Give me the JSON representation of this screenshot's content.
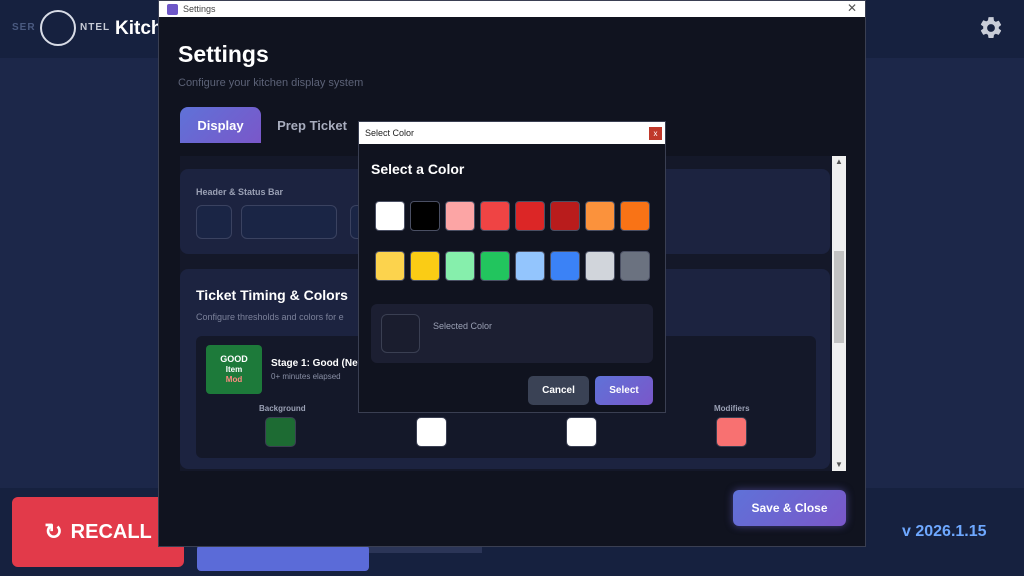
{
  "background_app": {
    "logo_text_left": "SER",
    "logo_text_right": "NTEL",
    "title": "Kitch",
    "recall_label": "RECALL",
    "recall_icon": "refresh-icon",
    "settings_icon": "gear-icon",
    "version": "v  2026.1.15"
  },
  "settings": {
    "window_title": "Settings",
    "heading": "Settings",
    "subtitle": "Configure your kitchen display system",
    "tabs": [
      {
        "label": "Display",
        "active": true
      },
      {
        "label": "Prep Ticket",
        "active": false
      }
    ],
    "header_card": {
      "label": "Header & Status Bar"
    },
    "timing_card": {
      "title": "Ticket Timing & Colors",
      "subtitle": "Configure thresholds and colors for e",
      "stage": {
        "preview_line1": "GOOD",
        "preview_line2": "Item",
        "preview_line3": "Mod",
        "name": "Stage 1: Good (Nev",
        "elapsed": "0+ minutes elapsed",
        "swatch_labels": [
          "Background",
          "Modifiers"
        ],
        "swatch_colors": [
          "#1d6b33",
          "#ffffff",
          "#ffffff",
          "#f87171"
        ]
      }
    },
    "save_close_label": "Save & Close"
  },
  "color_dialog": {
    "window_title": "Select Color",
    "close_label": "x",
    "heading": "Select a Color",
    "palette": [
      "#ffffff",
      "#000000",
      "#fca5a5",
      "#ef4444",
      "#dc2626",
      "#b91c1c",
      "#fb923c",
      "#f97316",
      "#fcd34d",
      "#facc15",
      "#86efac",
      "#22c55e",
      "#93c5fd",
      "#3b82f6",
      "#d1d5db",
      "#6b7280"
    ],
    "selected_label": "Selected Color",
    "cancel_label": "Cancel",
    "select_label": "Select"
  }
}
